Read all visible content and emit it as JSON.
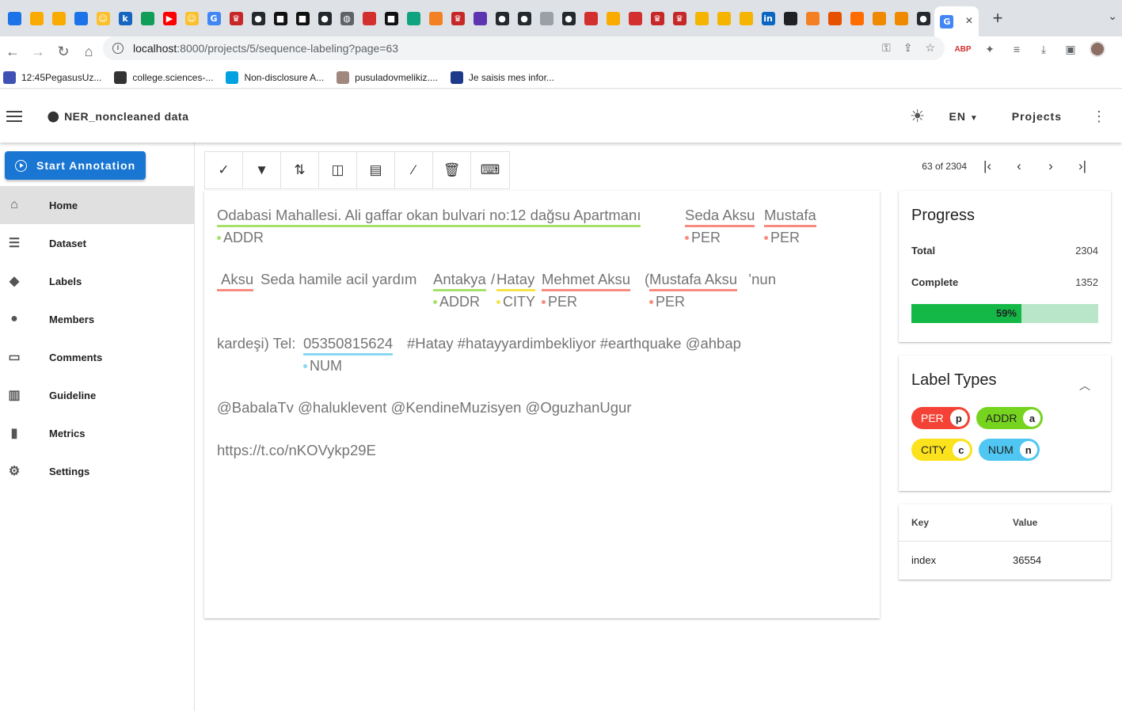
{
  "browser": {
    "tabs_count_icons": [
      "drive",
      "colab",
      "colab",
      "drive",
      "emoji",
      "k",
      "sheet",
      "youtube",
      "emoji",
      "google",
      "crown",
      "github",
      "medium",
      "medium",
      "github",
      "globe",
      "red",
      "medium",
      "openai",
      "stack",
      "crown",
      "mosque",
      "github",
      "github",
      "chart",
      "github",
      "red",
      "colab",
      "red",
      "crown",
      "crown",
      "slides",
      "slides",
      "slides",
      "linkedin",
      "dark",
      "stack",
      "shield",
      "ring",
      "books",
      "books",
      "github"
    ],
    "active_tab_close": "×",
    "new_tab": "+",
    "url_host": "localhost",
    "url_path": ":8000/projects/5/sequence-labeling?page=63"
  },
  "bookmarks": [
    {
      "label": "12:45PegasusUz...",
      "icon": "mail-icon"
    },
    {
      "label": "college.sciences-...",
      "icon": "globe-icon"
    },
    {
      "label": "Non-disclosure A...",
      "icon": "y-icon"
    },
    {
      "label": "pusuladovmelikiz....",
      "icon": "photo-icon"
    },
    {
      "label": "Je saisis mes infor...",
      "icon": "flag-icon"
    }
  ],
  "appbar": {
    "project_name": "NER_noncleaned data",
    "language": "EN",
    "projects": "Projects"
  },
  "sidebar": {
    "start_annotation": "Start Annotation",
    "items": [
      {
        "label": "Home",
        "icon": "home-icon"
      },
      {
        "label": "Dataset",
        "icon": "database-icon"
      },
      {
        "label": "Labels",
        "icon": "label-icon"
      },
      {
        "label": "Members",
        "icon": "person-icon"
      },
      {
        "label": "Comments",
        "icon": "comment-icon"
      },
      {
        "label": "Guideline",
        "icon": "book-icon"
      },
      {
        "label": "Metrics",
        "icon": "chart-icon"
      },
      {
        "label": "Settings",
        "icon": "gear-icon"
      }
    ]
  },
  "pager": {
    "text": "63 of 2304"
  },
  "document": {
    "line1": {
      "e1": "Odabasi Mahallesi. Ali gaffar okan bulvari no:12 dağsu Apartmanı",
      "e1_label": "ADDR",
      "e2": "Seda Aksu",
      "e2_label": "PER",
      "e3": "Mustafa",
      "e3_label": "PER"
    },
    "line2": {
      "e1": "Aksu",
      "t1": "Seda hamile acil yardım",
      "e2": "Antakya",
      "e2_label": "ADDR",
      "t2": "/",
      "e3": "Hatay",
      "e3_label": "CITY",
      "e4": "Mehmet Aksu",
      "e4_label": "PER",
      "t3": "(",
      "e5": "Mustafa Aksu",
      "e5_label": "PER",
      "t4": "’nun"
    },
    "line3": {
      "t1": "kardeşi) Tel:",
      "e1": "05350815624",
      "e1_label": "NUM",
      "t2": "#Hatay #hatayyardimbekliyor #earthquake @ahbap"
    },
    "line4": "@BabalaTv @haluklevent @KendineMuzisyen @OguzhanUgur",
    "line5": "https://t.co/nKOVykp29E"
  },
  "progress": {
    "title": "Progress",
    "total_label": "Total",
    "total": "2304",
    "complete_label": "Complete",
    "complete": "1352",
    "percent_text": "59%",
    "fraction": 0.59
  },
  "label_types": {
    "title": "Label Types",
    "labels": [
      {
        "name": "PER",
        "key": "p",
        "color": "#f44336",
        "text_color": "#ffffff"
      },
      {
        "name": "ADDR",
        "key": "a",
        "color": "#76d41f",
        "text_color": "#222222"
      },
      {
        "name": "CITY",
        "key": "c",
        "color": "#fbe21c",
        "text_color": "#222222"
      },
      {
        "name": "NUM",
        "key": "n",
        "color": "#4fc7f2",
        "text_color": "#222222"
      }
    ]
  },
  "metadata": {
    "key_header": "Key",
    "value_header": "Value",
    "rows": [
      {
        "key": "index",
        "value": "36554"
      }
    ]
  },
  "entity_colors": {
    "PER": "#f78b7f",
    "ADDR": "#a7e06b",
    "CITY": "#f3e44a",
    "NUM": "#88d7f2"
  }
}
